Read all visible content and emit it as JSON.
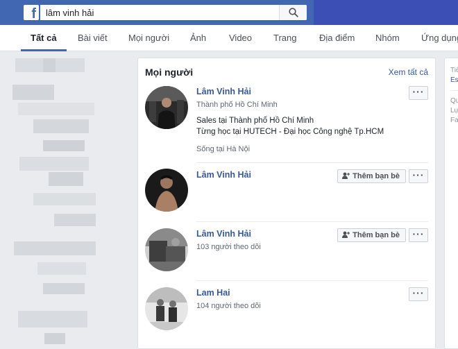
{
  "search": {
    "query": "lâm vinh hải"
  },
  "icons": {
    "logo": "facebook-f-icon",
    "search": "magnifier-icon",
    "more": "ellipsis-icon",
    "add_friend": "add-friend-icon"
  },
  "colors": {
    "brand": "#4267b2",
    "link": "#365899",
    "page_bg": "#e9ebee"
  },
  "tabs": [
    {
      "label": "Tất cả",
      "active": true
    },
    {
      "label": "Bài viết"
    },
    {
      "label": "Mọi người"
    },
    {
      "label": "Ảnh"
    },
    {
      "label": "Video"
    },
    {
      "label": "Trang"
    },
    {
      "label": "Địa điểm"
    },
    {
      "label": "Nhóm"
    },
    {
      "label": "Ứng dụng"
    }
  ],
  "people": {
    "title": "Mọi người",
    "see_all": "Xem tất cả",
    "results": [
      {
        "name": "Lâm Vinh Hải",
        "location": "Thành phố Hồ Chí Minh",
        "work": "Sales tại Thành phố Hồ Chí Minh",
        "education": "Từng học tại HUTECH - Đại học Công nghệ Tp.HCM",
        "lives": "Sống tại Hà Nội",
        "more": "···"
      },
      {
        "name": "Lâm Vinh Hải",
        "add_friend": "Thêm bạn bè",
        "more": "···"
      },
      {
        "name": "Lâm Vinh Hải",
        "followers": "103 người theo dõi",
        "add_friend": "Thêm bạn bè",
        "more": "···"
      },
      {
        "name": "Lam Hai",
        "followers": "104 người theo dõi",
        "more": "···"
      }
    ]
  },
  "right_panel": {
    "line1": "Tiế",
    "line2": "Es",
    "line3": "Qu",
    "line4": "Lự",
    "line5": "Fa"
  }
}
